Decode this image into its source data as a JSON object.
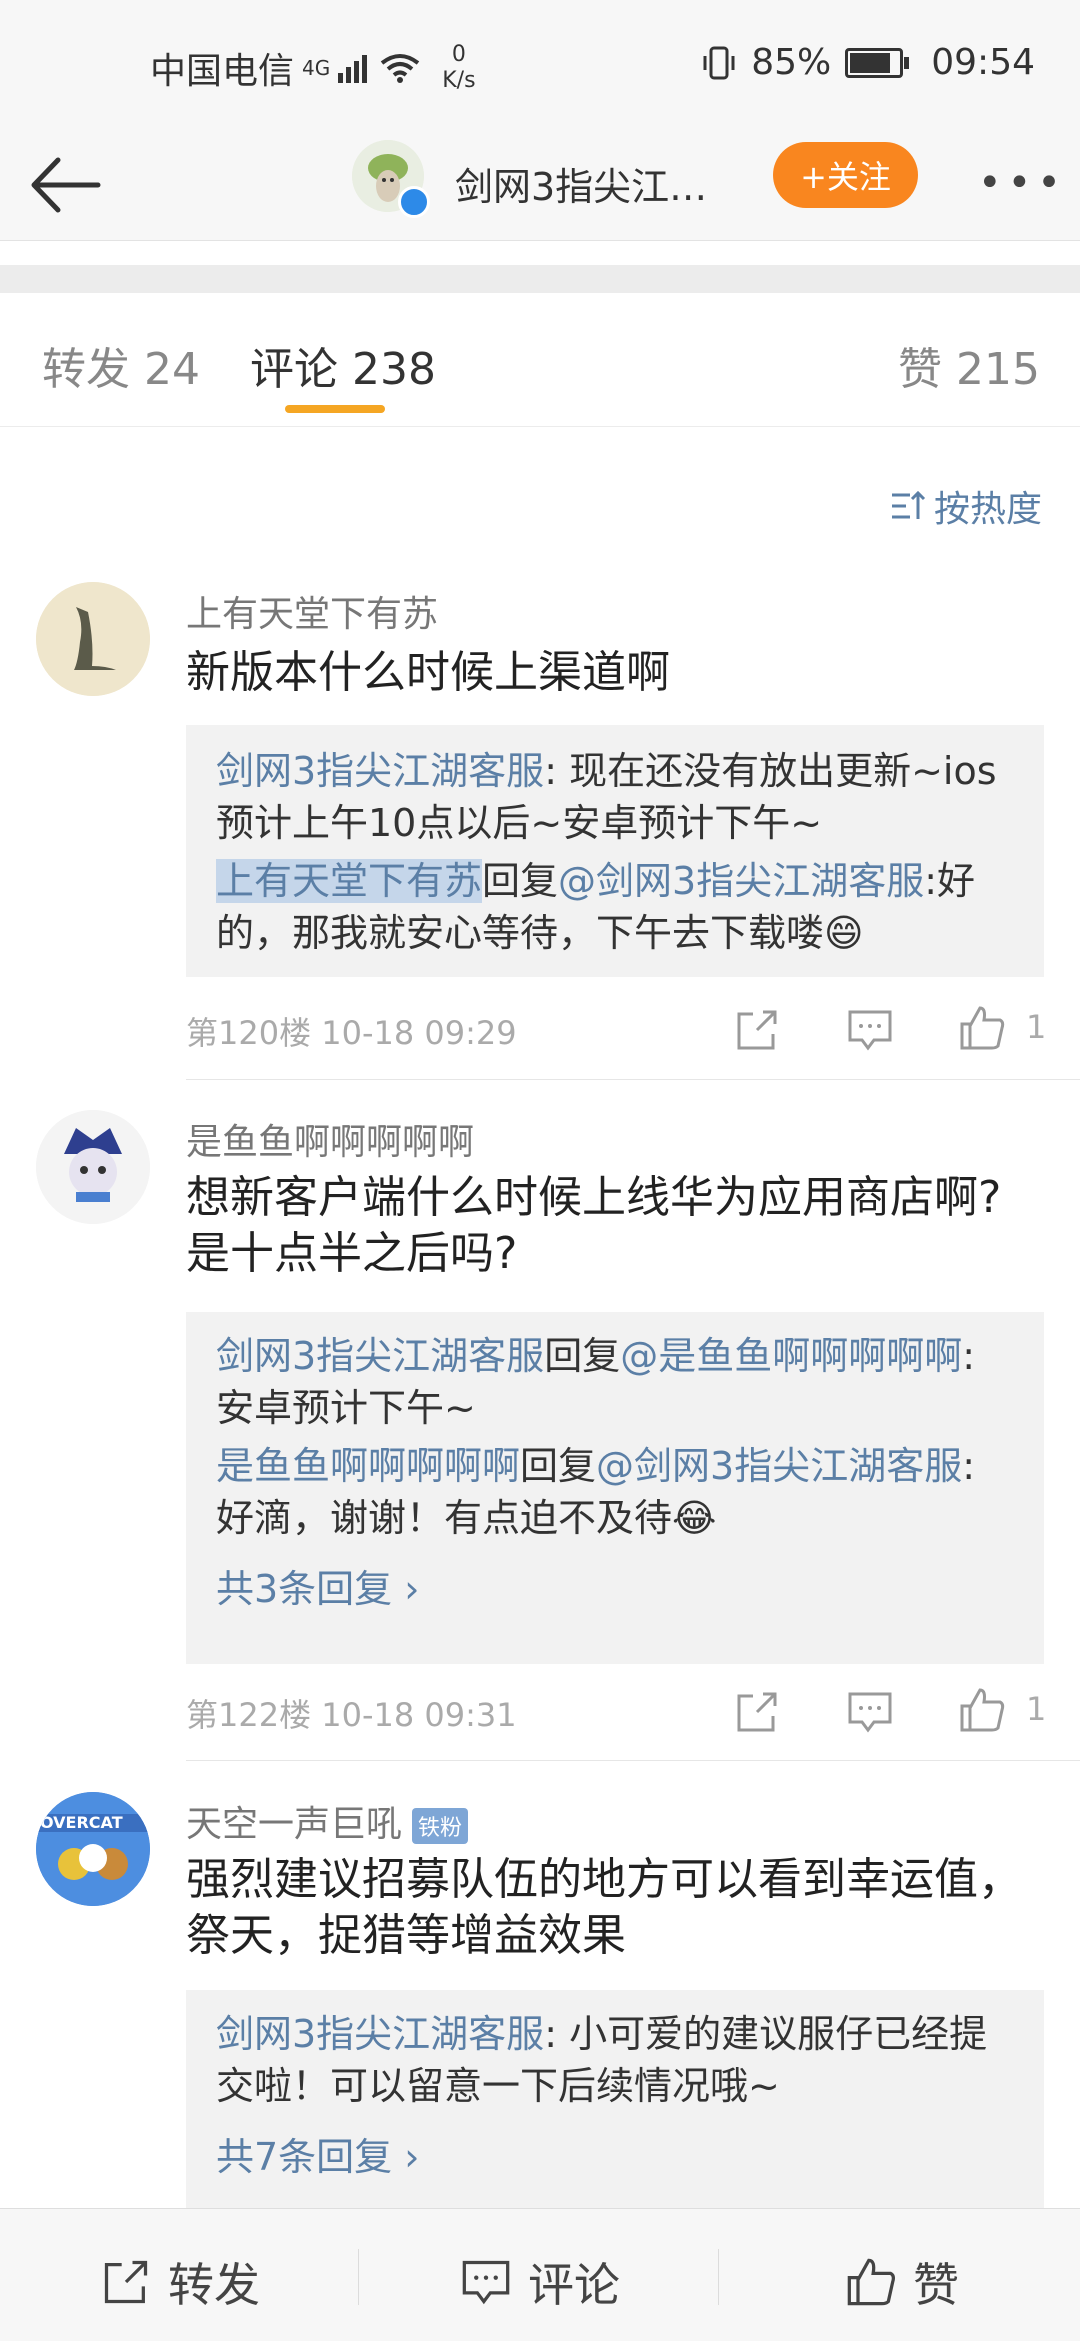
{
  "status_bar": {
    "carrier": "中国电信",
    "network": "4G",
    "net_speed_value": "0",
    "net_speed_unit": "K/s",
    "battery_percent": "85%",
    "battery_level": 0.85,
    "time": "09:54"
  },
  "nav": {
    "title": "剑网3指尖江…",
    "follow_label": "+关注",
    "more_label": "•••"
  },
  "tabs": {
    "repost": "转发 24",
    "comments": "评论 238",
    "likes": "赞 215"
  },
  "sort_label": "按热度",
  "comments": [
    {
      "user": "上有天堂下有苏",
      "text": "新版本什么时候上渠道啊",
      "replies": [
        {
          "from": "剑网3指尖江湖客服",
          "sep": ": ",
          "text1": "现在还没有放出更新~ios",
          "text2": "预计上午10点以后~安卓预计下午~"
        },
        {
          "from": "上有天堂下有苏",
          "verb": "回复",
          "to": "@剑网3指尖江湖客服",
          "sep": ":",
          "text1": "好",
          "text2": "的，那我就安心等待，下午去下载喽😄"
        }
      ],
      "floor": "第120楼",
      "time": "10-18 09:29",
      "like_count": "1"
    },
    {
      "user": "是鱼鱼啊啊啊啊啊",
      "text_line1": "想新客户端什么时候上线华为应用商店啊?",
      "text_line2": "是十点半之后吗?",
      "replies": [
        {
          "from": "剑网3指尖江湖客服",
          "verb": "回复",
          "to": "@是鱼鱼啊啊啊啊啊",
          "sep": ":",
          "text2": "安卓预计下午~"
        },
        {
          "from": "是鱼鱼啊啊啊啊啊",
          "verb": "回复",
          "to": "@剑网3指尖江湖客服",
          "sep": ":",
          "text2": "好滴，谢谢！有点迫不及待😂"
        }
      ],
      "more_replies": "共3条回复 ›",
      "floor": "第122楼",
      "time": "10-18 09:31",
      "like_count": "1"
    },
    {
      "user": "天空一声巨吼",
      "badge": "铁粉",
      "text_line1": "强烈建议招募队伍的地方可以看到幸运值，",
      "text_line2": "祭天，捉猎等增益效果",
      "replies": [
        {
          "from": "剑网3指尖江湖客服",
          "sep": ": ",
          "text1": "小可爱的建议服仔已经提",
          "text2": "交啦！可以留意一下后续情况哦~"
        }
      ],
      "more_replies": "共7条回复 ›"
    }
  ],
  "bottom_bar": {
    "repost": "转发",
    "comment": "评论",
    "like": "赞"
  },
  "colors": {
    "accent_orange": "#f9861f",
    "link_blue": "#5b7fa6",
    "tab_underline": "#f5a623"
  }
}
